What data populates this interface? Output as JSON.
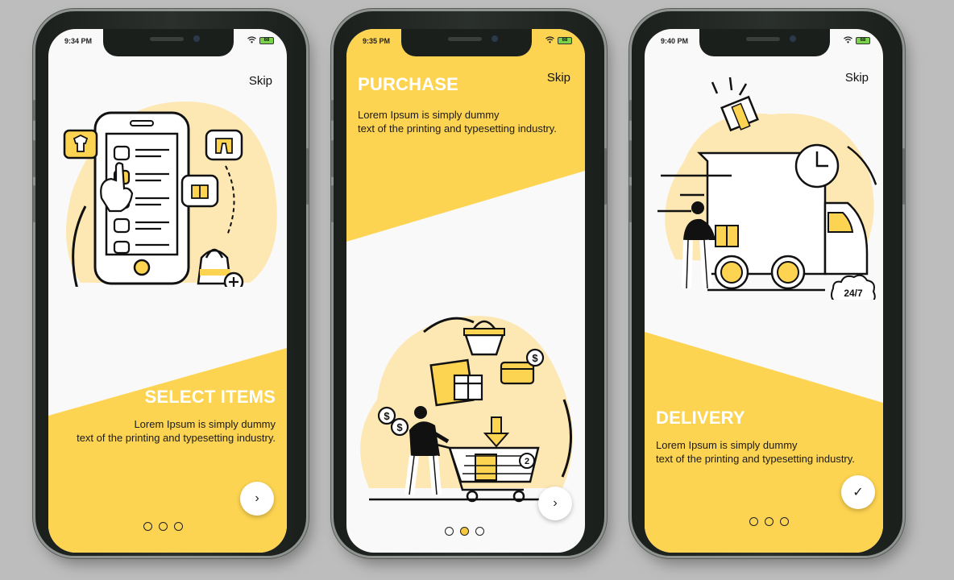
{
  "colors": {
    "accent": "#fdd451",
    "light_accent": "#fde8b4",
    "screen_bg": "#f9f9f9"
  },
  "screens": [
    {
      "time": "9:34 PM",
      "battery": "68",
      "skip_label": "Skip",
      "title": "SELECT ITEMS",
      "description_line1": "Lorem Ipsum is simply dummy",
      "description_line2": "text of the printing and typesetting industry.",
      "button_icon": "chevron-right-icon",
      "button_glyph": "›",
      "active_dot": 0
    },
    {
      "time": "9:35 PM",
      "battery": "68",
      "skip_label": "Skip",
      "title": "PURCHASE",
      "description_line1": "Lorem Ipsum is simply dummy",
      "description_line2": "text of the printing and typesetting industry.",
      "button_icon": "chevron-right-icon",
      "button_glyph": "›",
      "active_dot": 1
    },
    {
      "time": "9:40 PM",
      "battery": "68",
      "skip_label": "Skip",
      "title": "DELIVERY",
      "description_line1": "Lorem Ipsum is simply dummy",
      "description_line2": "text of the printing and typesetting industry.",
      "button_icon": "check-icon",
      "button_glyph": "✓",
      "badge_text": "24/7",
      "active_dot": null
    }
  ]
}
